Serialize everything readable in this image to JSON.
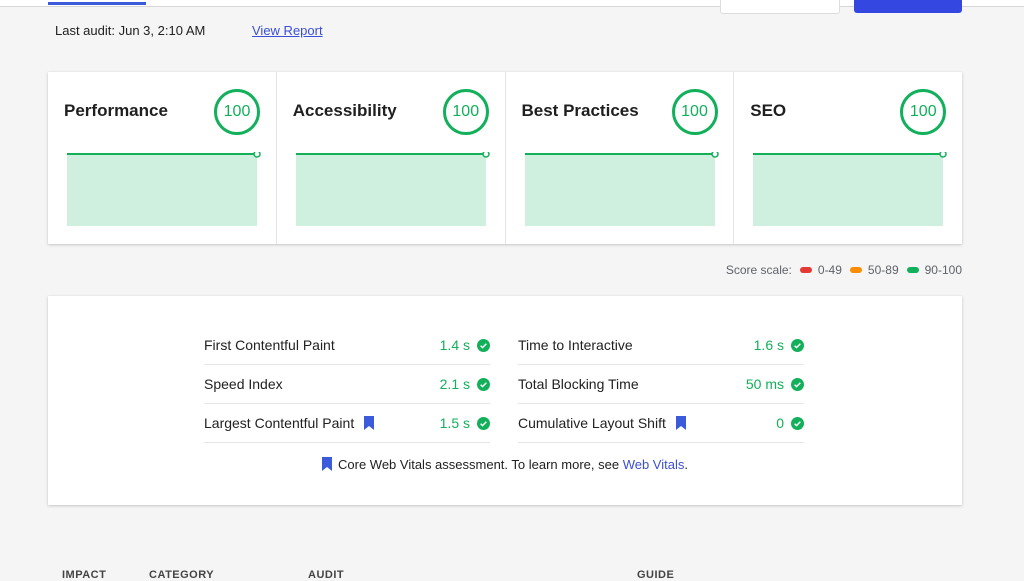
{
  "header": {
    "last_audit": "Last audit: Jun 3, 2:10 AM",
    "view_report": "View Report"
  },
  "categories": [
    {
      "name": "Performance",
      "score": "100",
      "history": [
        100,
        100
      ]
    },
    {
      "name": "Accessibility",
      "score": "100",
      "history": [
        100,
        100
      ]
    },
    {
      "name": "Best Practices",
      "score": "100",
      "history": [
        100,
        100
      ]
    },
    {
      "name": "SEO",
      "score": "100",
      "history": [
        100,
        100
      ]
    }
  ],
  "score_scale": {
    "label": "Score scale:",
    "ranges": [
      {
        "label": "0-49",
        "color": "#e53935"
      },
      {
        "label": "50-89",
        "color": "#fb8c00"
      },
      {
        "label": "90-100",
        "color": "#12b05a"
      }
    ]
  },
  "metrics": {
    "left": [
      {
        "name": "First Contentful Paint",
        "value": "1.4 s",
        "cwv": false
      },
      {
        "name": "Speed Index",
        "value": "2.1 s",
        "cwv": false
      },
      {
        "name": "Largest Contentful Paint",
        "value": "1.5 s",
        "cwv": true
      }
    ],
    "right": [
      {
        "name": "Time to Interactive",
        "value": "1.6 s",
        "cwv": false
      },
      {
        "name": "Total Blocking Time",
        "value": "50 ms",
        "cwv": false
      },
      {
        "name": "Cumulative Layout Shift",
        "value": "0",
        "cwv": true
      }
    ]
  },
  "cwv_note": {
    "text": "Core Web Vitals assessment. To learn more, see ",
    "link": "Web Vitals",
    "suffix": "."
  },
  "table_headers": [
    "IMPACT",
    "CATEGORY",
    "AUDIT",
    "GUIDE"
  ],
  "colors": {
    "good": "#12b05a",
    "accent": "#3447e0",
    "cwv_icon": "#3b5bdb"
  }
}
